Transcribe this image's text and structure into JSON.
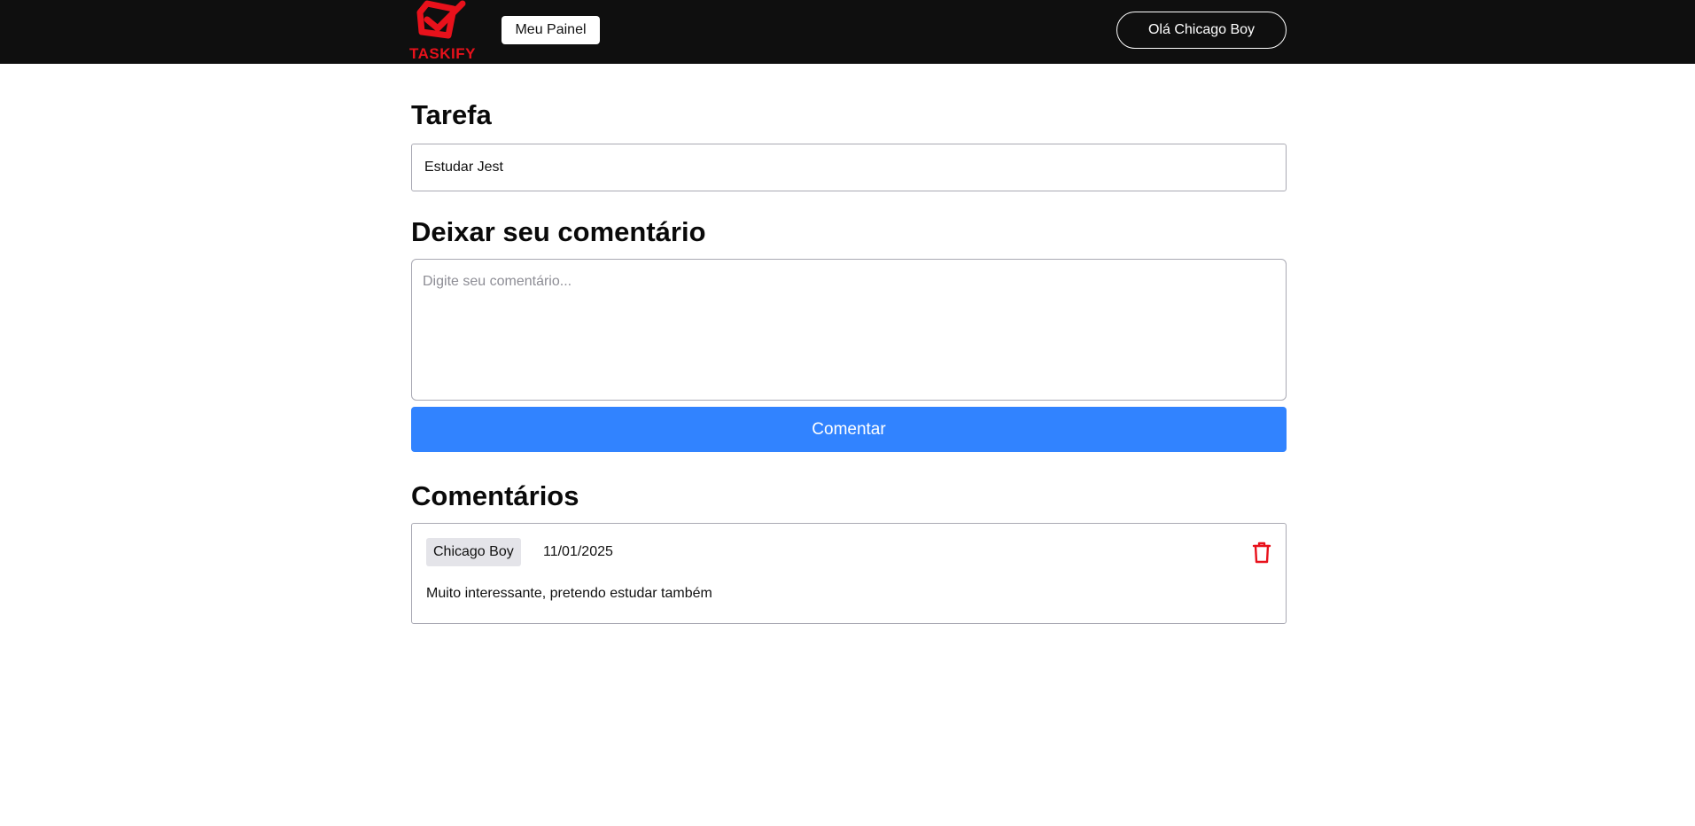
{
  "header": {
    "logo_text": "TASKIFY",
    "panel_button": "Meu Painel",
    "user_button": "Olá Chicago Boy",
    "background": "#0f0f0f",
    "brand_color": "#e8111b"
  },
  "task": {
    "heading": "Tarefa",
    "value": "Estudar Jest"
  },
  "comment_form": {
    "heading": "Deixar seu comentário",
    "placeholder": "Digite seu comentário...",
    "value": "",
    "submit_label": "Comentar",
    "accent": "#3183ff"
  },
  "comments": {
    "heading": "Comentários",
    "items": [
      {
        "author": "Chicago Boy",
        "date": "11/01/2025",
        "text": "Muito interessante, pretendo estudar também",
        "delete_icon": "trash-icon",
        "delete_color": "#e8111b"
      }
    ]
  }
}
